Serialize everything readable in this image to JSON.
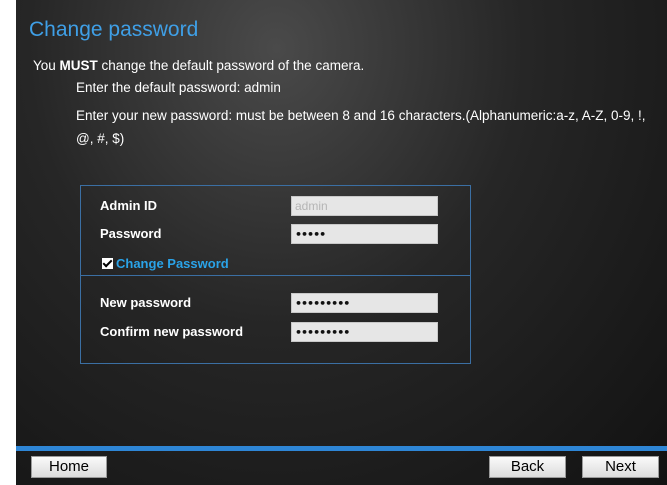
{
  "header": {
    "title": "Change password"
  },
  "intro": {
    "prefix": "You ",
    "emphasis": "MUST",
    "suffix": " change the default password of the camera.",
    "line1": "Enter the default password: admin",
    "line2": "Enter your new password: must be between 8 and 16 characters.(Alphanumeric:a-z, A-Z, 0-9, !, @, #, $)"
  },
  "form": {
    "admin_id_label": "Admin ID",
    "admin_id_value": "admin",
    "password_label": "Password",
    "password_value": "•••••",
    "change_password_label": "Change Password",
    "change_password_checked": true,
    "new_password_label": "New password",
    "new_password_value": "•••••••••",
    "confirm_password_label": "Confirm new password",
    "confirm_password_value": "•••••••••"
  },
  "footer": {
    "home_label": "Home",
    "back_label": "Back",
    "next_label": "Next"
  },
  "colors": {
    "title": "#3f9fe6",
    "accent_bar": "#2e86d6",
    "box_border": "#3b6fa3",
    "checkbox_label": "#2aa3e8"
  }
}
